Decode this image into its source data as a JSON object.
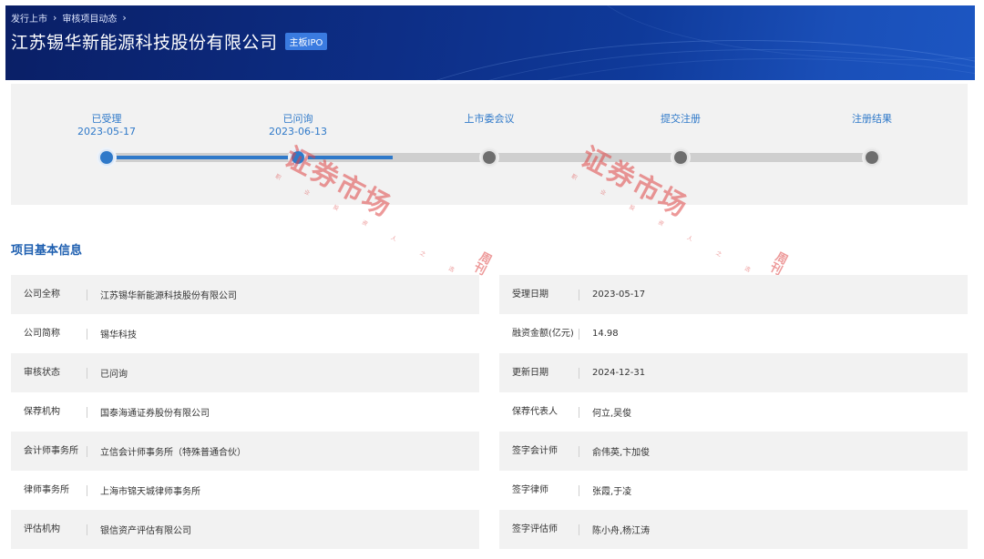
{
  "breadcrumb": [
    "发行上市",
    "审核项目动态"
  ],
  "header": {
    "company_name": "江苏锡华新能源科技股份有限公司",
    "board_badge": "主板IPO"
  },
  "progress": {
    "completed_fraction": 0.375,
    "steps": [
      {
        "label": "已受理",
        "date": "2023-05-17",
        "status": "done"
      },
      {
        "label": "已问询",
        "date": "2023-06-13",
        "status": "done"
      },
      {
        "label": "上市委会议",
        "date": "",
        "status": "pending"
      },
      {
        "label": "提交注册",
        "date": "",
        "status": "pending"
      },
      {
        "label": "注册结果",
        "date": "",
        "status": "pending"
      }
    ]
  },
  "watermark": {
    "text": "证券市场",
    "side": "周刊",
    "motto": "职 业 投 资 人 之 选",
    "tiny": "CAPITAL WEEK"
  },
  "section": {
    "title": "项目基本信息"
  },
  "info": {
    "left": [
      {
        "key": "公司全称",
        "value": "江苏锡华新能源科技股份有限公司"
      },
      {
        "key": "公司简称",
        "value": "锡华科技"
      },
      {
        "key": "审核状态",
        "value": "已问询"
      },
      {
        "key": "保荐机构",
        "value": "国泰海通证券股份有限公司"
      },
      {
        "key": "会计师事务所",
        "value": "立信会计师事务所（特殊普通合伙）"
      },
      {
        "key": "律师事务所",
        "value": "上海市锦天城律师事务所"
      },
      {
        "key": "评估机构",
        "value": "银信资产评估有限公司"
      }
    ],
    "right": [
      {
        "key": "受理日期",
        "value": "2023-05-17"
      },
      {
        "key": "融资金额(亿元)",
        "value": "14.98"
      },
      {
        "key": "更新日期",
        "value": "2024-12-31"
      },
      {
        "key": "保荐代表人",
        "value": "何立,吴俊"
      },
      {
        "key": "签字会计师",
        "value": "俞伟英,卞加俊"
      },
      {
        "key": "签字律师",
        "value": "张霞,于凌"
      },
      {
        "key": "签字评估师",
        "value": "陈小舟,杨江涛"
      }
    ]
  },
  "colors": {
    "banner": "#0d2e86",
    "accent": "#2f79c9",
    "section_title": "#1e5fb0",
    "row_shade": "#f2f2f2",
    "pending_node": "#6e6e6e"
  }
}
